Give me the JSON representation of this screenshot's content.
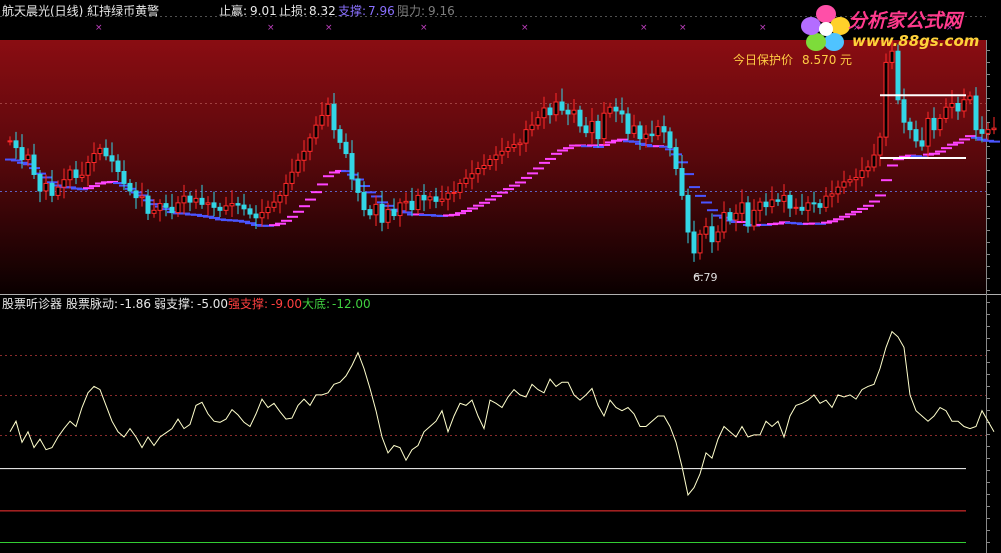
{
  "header": {
    "title": "航天晨光(日线) 紅持绿币黄警",
    "stop_profit_label": "止赢:",
    "stop_profit_value": "9.01",
    "stop_loss_label": "止损:",
    "stop_loss_value": "8.32",
    "support_label": "支撑:",
    "support_value": "7.96",
    "resistance_label": "阻力:",
    "resistance_value": "9.16"
  },
  "logo": {
    "cn_text": "分析家公式网",
    "url_text": "www.88gs.com"
  },
  "colors": {
    "price_up": "#ff2a2a",
    "price_down": "#33d6e6",
    "ma_line_bear": "#4a55ff",
    "ma_line_bull": "#ff44ff",
    "oscillator": "#ffffcc",
    "band_weak": "#ffffff",
    "band_strong": "#ff3333",
    "band_bottom": "#33cc33",
    "accent_yellow": "#ffcc44"
  },
  "main_panel": {
    "protect_label": "今日保护价",
    "protect_value": "8.570",
    "protect_unit": "元",
    "low_marker_label": "6.79"
  },
  "sub_panel": {
    "indicator_name": "股票听诊器",
    "pulse_label": "股票脉动:",
    "pulse_value": "-1.86",
    "weak_label": "弱支撑:",
    "weak_value": "-5.00",
    "strong_label": "强支撑:",
    "strong_value": "-9.00",
    "bottom_label": "大底:",
    "bottom_value": "-12.00"
  },
  "chart_data": [
    {
      "type": "candlestick",
      "title": "航天晨光(日线)",
      "annotations": [
        "今日保护价 8.570 元",
        "6.79"
      ],
      "ylim": [
        6.5,
        9.9
      ],
      "x": [
        0,
        1,
        2,
        3,
        4,
        5,
        6,
        7,
        8,
        9,
        10,
        11,
        12,
        13,
        14,
        15,
        16,
        17,
        18,
        19,
        20,
        21,
        22,
        23,
        24,
        25,
        26,
        27,
        28,
        29,
        30,
        31,
        32,
        33,
        34,
        35,
        36,
        37,
        38,
        39,
        40,
        41,
        42,
        43,
        44,
        45,
        46,
        47,
        48,
        49,
        50,
        51,
        52,
        53,
        54,
        55,
        56,
        57,
        58,
        59,
        60,
        61,
        62,
        63,
        64,
        65,
        66,
        67,
        68,
        69,
        70,
        71,
        72,
        73,
        74,
        75,
        76,
        77,
        78,
        79,
        80,
        81,
        82,
        83,
        84,
        85,
        86,
        87,
        88,
        89,
        90,
        91,
        92,
        93,
        94,
        95,
        96,
        97,
        98,
        99,
        100,
        101,
        102,
        103,
        104,
        105,
        106,
        107,
        108,
        109,
        110,
        111,
        112,
        113,
        114,
        115,
        116,
        117,
        118,
        119,
        120,
        121,
        122,
        123,
        124,
        125,
        126,
        127,
        128,
        129,
        130,
        131,
        132,
        133,
        134,
        135,
        136,
        137,
        138,
        139,
        140,
        141,
        142,
        143,
        144,
        145,
        146,
        147,
        148,
        149,
        150,
        151,
        152,
        153,
        154,
        155,
        156,
        157,
        158,
        159,
        160
      ],
      "close": [
        8.55,
        8.46,
        8.3,
        8.36,
        8.1,
        7.88,
        7.98,
        7.82,
        7.93,
        8.03,
        8.16,
        8.06,
        8.09,
        8.26,
        8.38,
        8.45,
        8.35,
        8.28,
        8.14,
        7.98,
        7.88,
        7.79,
        7.81,
        7.58,
        7.62,
        7.71,
        7.66,
        7.59,
        7.72,
        7.81,
        7.73,
        7.78,
        7.7,
        7.72,
        7.66,
        7.62,
        7.68,
        7.71,
        7.69,
        7.64,
        7.57,
        7.52,
        7.59,
        7.66,
        7.73,
        7.82,
        7.98,
        8.13,
        8.29,
        8.41,
        8.59,
        8.76,
        8.89,
        9.04,
        8.7,
        8.53,
        8.38,
        8.04,
        7.86,
        7.63,
        7.56,
        7.7,
        7.46,
        7.63,
        7.55,
        7.72,
        7.74,
        7.63,
        7.82,
        7.76,
        7.8,
        7.74,
        7.77,
        7.85,
        7.86,
        7.98,
        8.05,
        8.11,
        8.18,
        8.22,
        8.3,
        8.36,
        8.41,
        8.46,
        8.5,
        8.52,
        8.7,
        8.76,
        8.86,
        8.99,
        8.9,
        9.07,
        8.96,
        8.91,
        8.96,
        8.75,
        8.66,
        8.81,
        8.58,
        8.92,
        9.0,
        8.95,
        8.91,
        8.65,
        8.75,
        8.58,
        8.64,
        8.62,
        8.74,
        8.67,
        8.46,
        8.18,
        7.82,
        7.33,
        7.05,
        7.3,
        7.4,
        7.2,
        7.33,
        7.59,
        7.49,
        7.58,
        7.72,
        7.41,
        7.62,
        7.73,
        7.67,
        7.76,
        7.74,
        7.82,
        7.65,
        7.66,
        7.62,
        7.72,
        7.71,
        7.66,
        7.81,
        7.84,
        7.93,
        8.0,
        8.03,
        8.06,
        8.15,
        8.2,
        8.36,
        8.6,
        9.6,
        9.75,
        9.1,
        8.8,
        8.7,
        8.55,
        8.48,
        8.85,
        8.7,
        8.85,
        9.0,
        9.05,
        8.95,
        9.1,
        9.15,
        8.7,
        8.65,
        8.7,
        8.72
      ]
    },
    {
      "type": "line",
      "title": "股票听诊器",
      "series": [
        {
          "name": "股票脉动",
          "values": [
            -1.5,
            -0.5,
            -2.5,
            -1.5,
            -3.0,
            -2.2,
            -3.2,
            -3.0,
            -2.0,
            -1.2,
            -0.5,
            -1.0,
            0.8,
            2.2,
            2.8,
            2.5,
            1.0,
            -0.5,
            -1.5,
            -2.0,
            -1.2,
            -2.0,
            -3.0,
            -2.0,
            -2.8,
            -2.0,
            -1.6,
            -1.2,
            -0.3,
            -1.2,
            -0.8,
            1.0,
            1.3,
            0.2,
            -0.5,
            -0.6,
            -0.3,
            0.6,
            0.1,
            -0.6,
            -1.0,
            0.2,
            1.6,
            0.8,
            1.2,
            0.4,
            -0.3,
            -0.2,
            1.0,
            1.6,
            1.0,
            2.0,
            2.0,
            2.2,
            3.0,
            3.2,
            3.8,
            4.8,
            6.0,
            4.5,
            2.6,
            0.5,
            -2.0,
            -3.5,
            -2.8,
            -3.0,
            -4.2,
            -3.2,
            -2.8,
            -1.5,
            -1.0,
            -0.5,
            0.5,
            -1.5,
            0.0,
            1.2,
            1.0,
            1.5,
            0.0,
            -1.2,
            1.5,
            1.2,
            0.8,
            1.8,
            2.5,
            2.0,
            1.8,
            3.0,
            2.5,
            2.2,
            3.5,
            2.8,
            3.2,
            3.2,
            2.0,
            1.5,
            2.0,
            2.6,
            1.0,
            0.0,
            1.5,
            0.8,
            0.5,
            0.8,
            0.2,
            -1.0,
            -1.0,
            -0.5,
            0.0,
            0.0,
            -1.0,
            -2.5,
            -4.8,
            -7.5,
            -6.8,
            -5.5,
            -3.5,
            -4.0,
            -2.2,
            -1.0,
            -1.5,
            -2.0,
            -1.0,
            -2.0,
            -1.8,
            -1.8,
            -0.5,
            -1.0,
            -0.5,
            -2.0,
            0.0,
            1.0,
            1.2,
            1.5,
            2.0,
            1.2,
            1.5,
            0.8,
            2.0,
            1.8,
            2.0,
            1.6,
            2.5,
            2.8,
            3.0,
            4.5,
            6.5,
            8.0,
            7.5,
            6.5,
            2.0,
            0.5,
            0.0,
            -0.5,
            0.0,
            0.8,
            0.5,
            -0.5,
            -0.5,
            -1.0,
            -1.2,
            -1.0,
            0.5,
            -0.5,
            -1.5
          ]
        },
        {
          "name": "弱支撑",
          "values": [
            -5.0
          ]
        },
        {
          "name": "强支撑",
          "values": [
            -9.0
          ]
        },
        {
          "name": "大底",
          "values": [
            -12.0
          ]
        }
      ],
      "ylim": [
        -13,
        11
      ]
    }
  ]
}
